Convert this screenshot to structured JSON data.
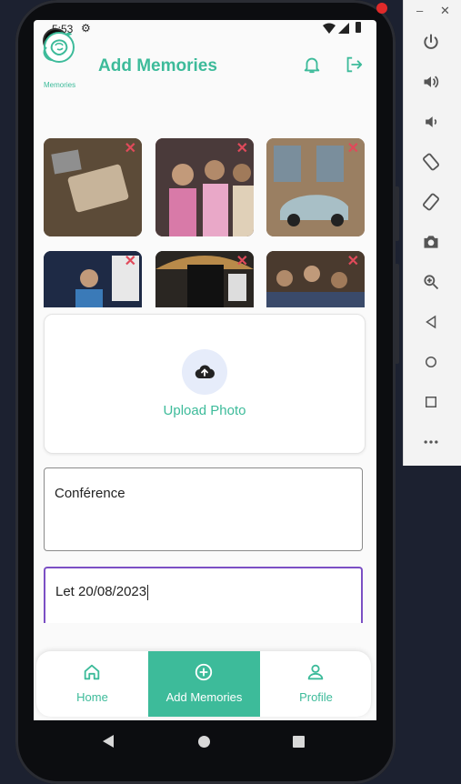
{
  "status_bar": {
    "time": "5:53"
  },
  "app_bar": {
    "logo_text": "Memories",
    "title": "Add Memories",
    "icons": [
      "bell-icon",
      "logout-icon"
    ]
  },
  "photos": [
    {
      "desc": "book and photos",
      "color": "#6b5a46"
    },
    {
      "desc": "people audience",
      "color": "#8a4a55"
    },
    {
      "desc": "vintage car",
      "color": "#8b7868"
    },
    {
      "desc": "event speaker",
      "color": "#2d3a55"
    },
    {
      "desc": "exhibition booth",
      "color": "#3a3a3a"
    },
    {
      "desc": "crowd",
      "color": "#5a4a3a"
    }
  ],
  "upload": {
    "label": "Upload Photo"
  },
  "fields": {
    "title_value": "Conférence",
    "description_value": "Let 20/08/2023"
  },
  "bottom_nav": {
    "items": [
      {
        "label": "Home",
        "icon": "home-icon"
      },
      {
        "label": "Add Memories",
        "icon": "add-circle-icon"
      },
      {
        "label": "Profile",
        "icon": "profile-icon"
      }
    ]
  },
  "colors": {
    "accent": "#3dbb9a",
    "focus": "#7b4fc4",
    "close": "#e04a5a"
  }
}
